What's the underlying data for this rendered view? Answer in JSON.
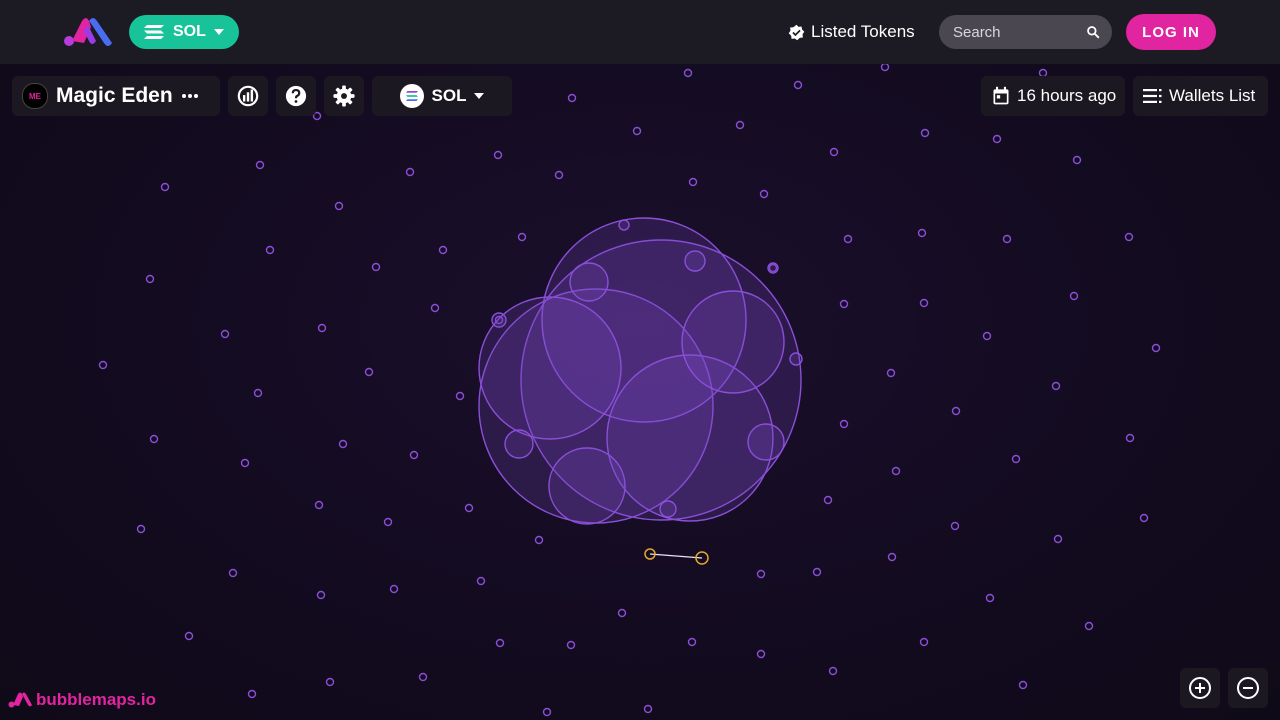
{
  "header": {
    "chain_label": "SOL",
    "listed_tokens_label": "Listed Tokens",
    "search_placeholder": "Search",
    "login_label": "LOG IN"
  },
  "toolbar": {
    "token_name": "Magic Eden",
    "token_avatar_text": "ME",
    "currency_label": "SOL",
    "timestamp": "16 hours ago",
    "wallets_list_label": "Wallets List"
  },
  "footer": {
    "brand_label": "bubblemaps.io"
  },
  "icons": {
    "logo": "bubblemaps-logo-icon",
    "listed": "verified-check-icon",
    "search": "search-icon",
    "more": "more-horizontal-icon",
    "chart": "chart-icon",
    "help": "help-icon",
    "settings": "gear-icon",
    "calendar": "calendar-icon",
    "list": "list-icon",
    "zoom_in": "zoom-in-icon",
    "zoom_out": "zoom-out-icon"
  },
  "colors": {
    "accent_pink": "#e1249f",
    "accent_green": "#19c39a",
    "bubble_purple": "#8a4fd8",
    "highlight_gold": "#e0a830"
  }
}
